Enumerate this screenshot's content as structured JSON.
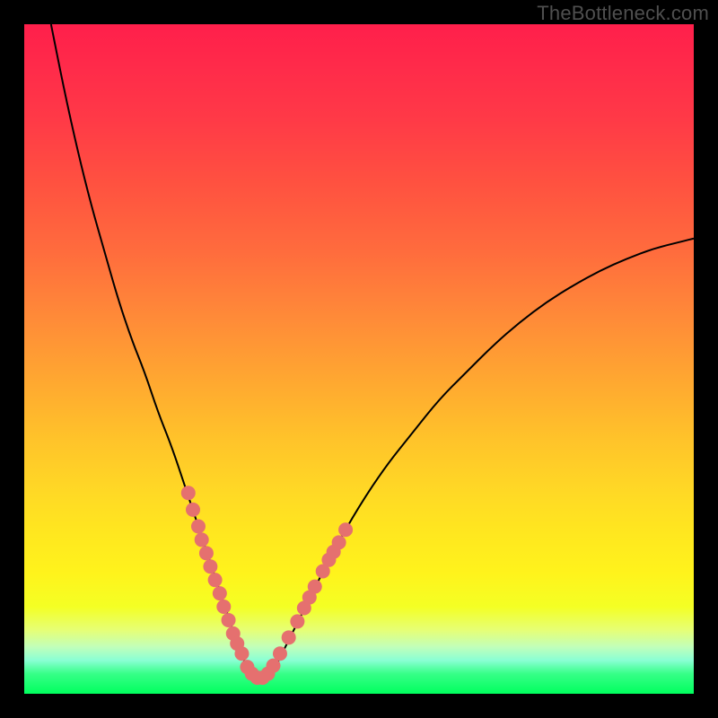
{
  "watermark": "TheBottleneck.com",
  "colors": {
    "frame": "#000000",
    "curve": "#000000",
    "dots": "#e5706f"
  },
  "chart_data": {
    "type": "line",
    "title": "",
    "xlabel": "",
    "ylabel": "",
    "xlim": [
      0,
      100
    ],
    "ylim": [
      0,
      100
    ],
    "grid": false,
    "legend": false,
    "note": "V-shaped bottleneck curve over rainbow heat gradient. Curve left branch descends from top-left to valley near x≈34, right branch rises toward upper-right. Pink dots (approximate series sample) cluster along the lower portion of both branches.",
    "series": [
      {
        "name": "curve",
        "x": [
          4,
          6,
          8,
          10,
          12,
          14,
          16,
          18,
          20,
          22,
          24,
          26,
          28,
          30,
          32,
          33,
          34,
          35,
          36,
          37,
          38,
          40,
          42,
          44,
          46,
          50,
          54,
          58,
          62,
          66,
          70,
          74,
          78,
          82,
          86,
          90,
          94,
          98,
          100
        ],
        "y": [
          100,
          90,
          81,
          73,
          66,
          59,
          53,
          48,
          42,
          37,
          31,
          25,
          19,
          13,
          7,
          4.5,
          3,
          2.3,
          2.3,
          3,
          5,
          9,
          13,
          17,
          21,
          28,
          34,
          39,
          44,
          48,
          52,
          55.5,
          58.5,
          61,
          63.2,
          65,
          66.5,
          67.5,
          68
        ]
      },
      {
        "name": "dots",
        "x": [
          24.5,
          25.2,
          26,
          26.5,
          27.2,
          27.8,
          28.5,
          29.2,
          29.8,
          30.5,
          31.2,
          31.8,
          32.5,
          33.3,
          34,
          34.8,
          35.6,
          36.4,
          37.2,
          38.2,
          39.5,
          40.8,
          41.8,
          42.6,
          43.4,
          44.6,
          45.5,
          46.2,
          47,
          48
        ],
        "y": [
          30,
          27.5,
          25,
          23,
          21,
          19,
          17,
          15,
          13,
          11,
          9,
          7.5,
          6,
          4,
          3,
          2.4,
          2.4,
          3,
          4.2,
          6,
          8.4,
          10.8,
          12.8,
          14.4,
          16,
          18.3,
          20,
          21.2,
          22.6,
          24.5
        ]
      }
    ]
  }
}
